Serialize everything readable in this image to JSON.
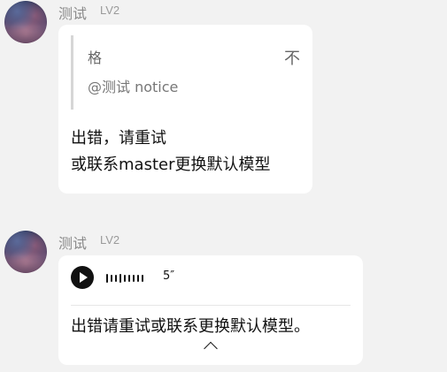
{
  "messages": [
    {
      "user": {
        "name": "测试",
        "level": "LV2",
        "avatar": "avatar-image"
      },
      "quote": {
        "title": "格",
        "subtitle": "@测试 notice",
        "icon": "not-icon"
      },
      "text": "出错，请重试\n或联系master更换默认模型"
    },
    {
      "user": {
        "name": "测试",
        "level": "LV2",
        "avatar": "avatar-image"
      },
      "voice": {
        "duration": "5″",
        "icon": "play-icon"
      },
      "transcript": "出错请重试或联系更换默认模型。",
      "collapse_icon": "chevron-up-icon"
    }
  ]
}
